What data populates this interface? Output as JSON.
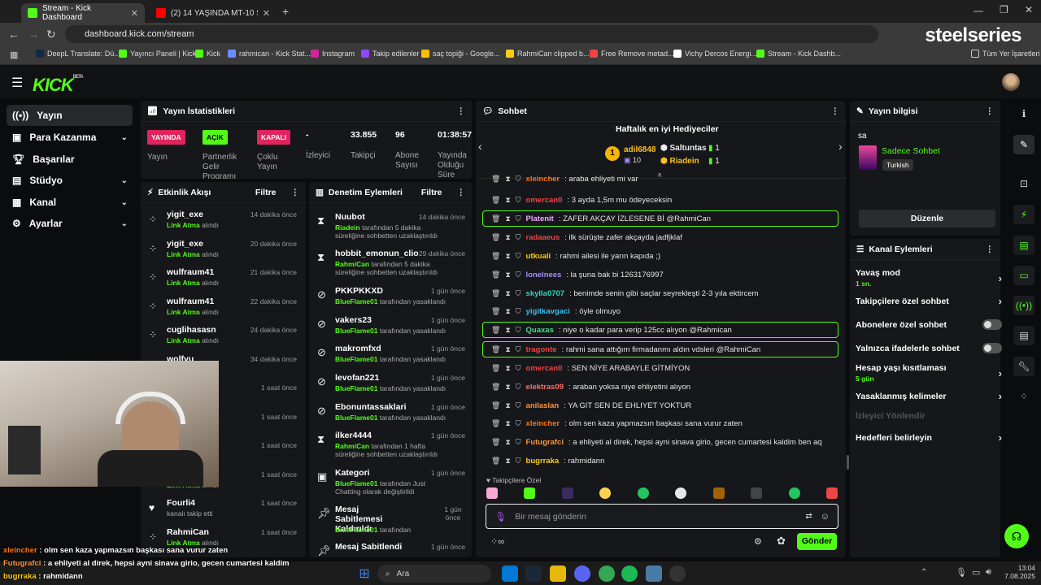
{
  "browser": {
    "tabs": [
      {
        "title": "Stream - Kick Dashboard",
        "active": true
      },
      {
        "title": "(2) 14 YAŞINDA MT-10 SAHİBİ (",
        "active": false
      }
    ],
    "url": "dashboard.kick.com/stream",
    "brand_overlay": "steelseries",
    "bookmarks": [
      "DeepL Translate: Dü...",
      "Yayıncı Paneli | Kick",
      "Kick",
      "rahmican - Kick Stat...",
      "Instagram",
      "Takip edilenler",
      "saç topiği - Google...",
      "RahmiCan clipped b...",
      "Free Remove metad...",
      "Vichy Dercos Energi...",
      "Stream - Kick Dashb..."
    ],
    "all_bookmarks": "Tüm Yer İşaretleri"
  },
  "kick": {
    "logo": "KICK",
    "logo_sup": "BETA"
  },
  "sidebar": {
    "items": [
      {
        "label": "Yayın",
        "icon": "broadcast-icon"
      },
      {
        "label": "Para Kazanma",
        "icon": "money-icon"
      },
      {
        "label": "Başarılar",
        "icon": "trophy-icon"
      },
      {
        "label": "Stüdyo",
        "icon": "studio-icon"
      },
      {
        "label": "Kanal",
        "icon": "channel-icon"
      },
      {
        "label": "Ayarlar",
        "icon": "gear-icon"
      }
    ]
  },
  "stats": {
    "title": "Yayın İstatistikleri",
    "items": [
      {
        "badge": "YAYINDA",
        "label": "Yayın",
        "color": "#e0245e"
      },
      {
        "badge": "AÇIK",
        "label": "Partnerlik Gelir Programı",
        "color": "#53fc18"
      },
      {
        "badge": "KAPALI",
        "label": "Çoklu Yayın",
        "color": "#e0245e"
      },
      {
        "value": "-",
        "label": "İzleyici"
      },
      {
        "value": "33.855",
        "label": "Takipçi"
      },
      {
        "value": "96",
        "label": "Abone Sayısı"
      },
      {
        "value": "01:38:57",
        "label": "Yayında Olduğu Süre"
      }
    ]
  },
  "activity": {
    "title": "Etkinlik Akışı",
    "filter": "Filtre",
    "items": [
      {
        "name": "yigit_exe",
        "action": "Link Atma",
        "suffix": "alındı",
        "time": "14 dakika önce"
      },
      {
        "name": "yigit_exe",
        "action": "Link Atma",
        "suffix": "alındı",
        "time": "20 dakika önce"
      },
      {
        "name": "wulfraum41",
        "action": "Link Atma",
        "suffix": "alındı",
        "time": "21 dakika önce"
      },
      {
        "name": "wulfraum41",
        "action": "Link Atma",
        "suffix": "alındı",
        "time": "22 dakika önce"
      },
      {
        "name": "cuglihasasn",
        "action": "Link Atma",
        "suffix": "alındı",
        "time": "24 dakika önce"
      },
      {
        "name": "wolfvu",
        "action": "",
        "suffix": "",
        "time": "34 dakika önce"
      },
      {
        "name": "",
        "action": "",
        "suffix": "",
        "time": "1 saat önce"
      },
      {
        "name": "",
        "action": "",
        "suffix": "",
        "time": "1 saat önce"
      },
      {
        "name": "",
        "action": "",
        "suffix": "",
        "time": "1 saat önce"
      },
      {
        "name": "",
        "action": "Link Atma",
        "suffix": "alındı",
        "time": "1 saat önce"
      },
      {
        "name": "Fourli4",
        "action": "",
        "suffix": "kanalı takip etti",
        "time": "1 saat önce"
      },
      {
        "name": "RahmiCan",
        "action": "Link Atma",
        "suffix": "alındı",
        "time": "1 saat önce"
      }
    ]
  },
  "moderation": {
    "title": "Denetim Eylemleri",
    "filter": "Filtre",
    "items": [
      {
        "name": "Nuubot",
        "by": "Riadein",
        "text": "tarafından 5 dakika süreliğine sohbetten uzaklaştırıldı",
        "time": "14 dakika önce"
      },
      {
        "name": "hobbit_emonun_clio",
        "by": "RahmiCan",
        "text": "tarafından 5 dakika süreliğine sohbetten uzaklaştırıldı",
        "time": "29 dakika önce"
      },
      {
        "name": "PKKPKKXD",
        "by": "BlueFlame01",
        "text": "tarafından yasaklandı",
        "time": "1 gün önce"
      },
      {
        "name": "vakers23",
        "by": "BlueFlame01",
        "text": "tarafından yasaklandı",
        "time": "1 gün önce"
      },
      {
        "name": "makromfxd",
        "by": "BlueFlame01",
        "text": "tarafından yasaklandı",
        "time": "1 gün önce"
      },
      {
        "name": "levofan221",
        "by": "BlueFlame01",
        "text": "tarafından yasaklandı",
        "time": "1 gün önce"
      },
      {
        "name": "Ebonuntassaklari",
        "by": "BlueFlame01",
        "text": "tarafından yasaklandı",
        "time": "1 gün önce"
      },
      {
        "name": "ilker4444",
        "by": "RahmiCan",
        "text": "tarafından 1 hafta süreliğine sohbetten uzaklaştırıldı",
        "time": "1 gün önce"
      },
      {
        "name": "Kategori",
        "by": "BlueFlame01",
        "text": "tarafından Just Chatting olarak değiştirildi",
        "time": "1 gün önce"
      },
      {
        "name": "Mesaj Sabitlemesi Kaldırıldı",
        "by": "BlueFlame01",
        "text": "tarafından",
        "time": "1 gün önce"
      },
      {
        "name": "Mesaj Sabitlendi",
        "by": "",
        "text": "",
        "time": "1 gün önce"
      }
    ]
  },
  "chat": {
    "title": "Sohbet",
    "gifters_title": "Haftalık en iyi Hediyeciler",
    "gifters": [
      {
        "name": "adil6848",
        "count": "10"
      },
      {
        "name": "Saltuntas",
        "count": "1"
      },
      {
        "name": "Riadein",
        "count": "1"
      }
    ],
    "messages": [
      {
        "user": "xleincher",
        "color": "#f97316",
        "text": "araba ehliyeti mi var",
        "hl": false
      },
      {
        "user": "omercan0",
        "color": "#ef4444",
        "text": "3 ayda 1,5m mu ödeyeceksin",
        "hl": false
      },
      {
        "user": "Platenit",
        "color": "#f0abfc",
        "text": "ZAFER AKÇAY İZLESENE Bİ @RahmiCan",
        "hl": true
      },
      {
        "user": "radaaeus",
        "color": "#ef4444",
        "text": "ilk sürüşte zafer akçayda jadfjklaf",
        "hl": false
      },
      {
        "user": "utkuali",
        "color": "#facc15",
        "text": "rahmi ailesi ile yarın kapıda ;)",
        "hl": false
      },
      {
        "user": "lonelnees",
        "color": "#a78bfa",
        "text": "la şuna bak bi 1263176997",
        "hl": false
      },
      {
        "user": "skylla0707",
        "color": "#2dd4bf",
        "text": "benimde senin gibi saçlar seyrekleşti 2-3 yıla ektircem",
        "hl": false
      },
      {
        "user": "yigitkavgaci",
        "color": "#38bdf8",
        "text": "öyle olmuyo",
        "hl": false
      },
      {
        "user": "Quaxas",
        "color": "#4ade80",
        "text": "niye o kadar para verip 125cc alıyon @Rahmican",
        "hl": true
      },
      {
        "user": "tragonte",
        "color": "#ef4444",
        "text": "rahmi sana attığım firmadanmı aldın vdsleri @RahmiCan",
        "hl": true
      },
      {
        "user": "omercan0",
        "color": "#ef4444",
        "text": "SEN NİYE ARABAYLE GİTMİYON",
        "hl": false
      },
      {
        "user": "elektras09",
        "color": "#f87171",
        "text": "araban yoksa niye ehliyetini alıyon",
        "hl": false
      },
      {
        "user": "anilaslan",
        "color": "#fb923c",
        "text": "YA GIT SEN DE EHLIYET YOKTUR",
        "hl": false
      },
      {
        "user": "xleincher",
        "color": "#f97316",
        "text": "olm sen kaza yapmazsın başkası sana vurur zaten",
        "hl": false
      },
      {
        "user": "Futugrafci",
        "color": "#fb923c",
        "text": "a ehliyeti al direk, hepsi ayni sinava girio, gecen cumartesi kaldim ben aq",
        "hl": false
      },
      {
        "user": "bugrraka",
        "color": "#facc15",
        "text": "rahmidann",
        "hl": false
      }
    ],
    "followers_only": "Takipçilere Özel",
    "input_placeholder": "Bir mesaj gönderin",
    "send": "Gönder"
  },
  "stream_info": {
    "title": "Yayın bilgisi",
    "stream_title": "sa",
    "category": "Sadece Sohbet",
    "language": "Turkish",
    "edit": "Düzenle"
  },
  "channel_actions": {
    "title": "Kanal Eylemleri",
    "items": [
      {
        "label": "Yavaş mod",
        "sub": "1 sn.",
        "type": "chev"
      },
      {
        "label": "Takipçilere özel sohbet",
        "sub": "",
        "type": "chev"
      },
      {
        "label": "Abonelere özel sohbet",
        "sub": "",
        "type": "toggle"
      },
      {
        "label": "Yalnızca ifadelerle sohbet",
        "sub": "",
        "type": "toggle"
      },
      {
        "label": "Hesap yaşı kısıtlaması",
        "sub": "5 gün",
        "type": "chev"
      },
      {
        "label": "Yasaklanmış kelimeler",
        "sub": "",
        "type": "chev"
      },
      {
        "label": "İzleyici Yönlendir",
        "sub": "",
        "type": "disabled"
      },
      {
        "label": "Hedefleri belirleyin",
        "sub": "",
        "type": "chev"
      }
    ]
  },
  "overlay": {
    "lines": [
      {
        "user": "xleincher",
        "text": " : olm sen kaza yapmazsın başkası sana vurur zaten",
        "color": "#f97316"
      },
      {
        "user": "Futugrafci",
        "text": " : a ehliyeti al direk, hepsi ayni sinava girio, gecen cumartesi kaldim",
        "color": "#fb923c"
      },
      {
        "user": "bugrraka",
        "text": " : rahmidann",
        "color": "#facc15"
      }
    ]
  },
  "taskbar": {
    "search": "Ara",
    "time": "13:04",
    "date": "7.08.2025"
  },
  "colors": {
    "accent": "#53fc18",
    "live": "#e0245e"
  }
}
